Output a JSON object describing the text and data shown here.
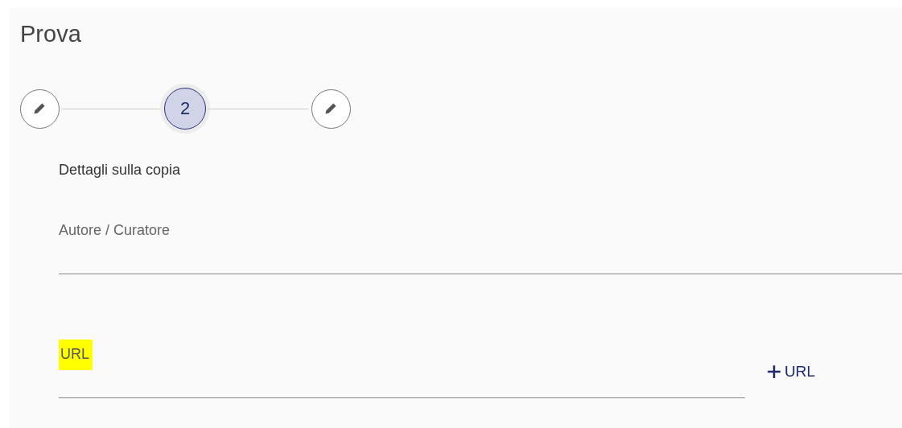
{
  "title": "Prova",
  "steps": [
    {
      "kind": "edit",
      "selected": false
    },
    {
      "kind": "number",
      "label": "2",
      "selected": true
    },
    {
      "kind": "edit",
      "selected": false
    }
  ],
  "section_title": "Dettagli sulla copia",
  "fields": [
    {
      "placeholder": "Autore / Curatore",
      "highlighted": false
    },
    {
      "placeholder": "URL",
      "highlighted": true
    }
  ],
  "add_button": {
    "label": "URL"
  }
}
